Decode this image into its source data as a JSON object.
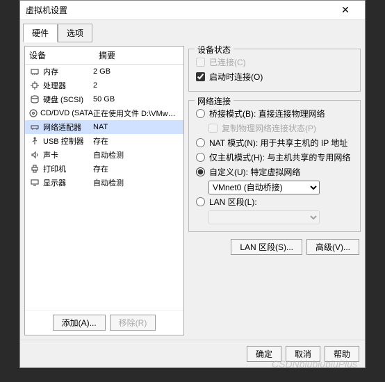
{
  "window": {
    "title": "虚拟机设置"
  },
  "tabs": {
    "hardware": "硬件",
    "options": "选项"
  },
  "hw_header": {
    "device": "设备",
    "summary": "摘要"
  },
  "hardware": [
    {
      "icon": "memory-icon",
      "name": "内存",
      "summary": "2 GB"
    },
    {
      "icon": "cpu-icon",
      "name": "处理器",
      "summary": "2"
    },
    {
      "icon": "disk-icon",
      "name": "硬盘 (SCSI)",
      "summary": "50 GB"
    },
    {
      "icon": "cd-icon",
      "name": "CD/DVD (SATA)",
      "summary": "正在使用文件 D:\\VMware\\ubu..."
    },
    {
      "icon": "network-icon",
      "name": "网络适配器",
      "summary": "NAT"
    },
    {
      "icon": "usb-icon",
      "name": "USB 控制器",
      "summary": "存在"
    },
    {
      "icon": "sound-icon",
      "name": "声卡",
      "summary": "自动检测"
    },
    {
      "icon": "printer-icon",
      "name": "打印机",
      "summary": "存在"
    },
    {
      "icon": "display-icon",
      "name": "显示器",
      "summary": "自动检测"
    }
  ],
  "hw_buttons": {
    "add": "添加(A)...",
    "remove": "移除(R)"
  },
  "device_state": {
    "title": "设备状态",
    "connected": "已连接(C)",
    "connect_on_power": "启动时连接(O)"
  },
  "network": {
    "title": "网络连接",
    "bridged": "桥接模式(B): 直接连接物理网络",
    "replicate": "复制物理网络连接状态(P)",
    "nat": "NAT 模式(N): 用于共享主机的 IP 地址",
    "hostonly": "仅主机模式(H): 与主机共享的专用网络",
    "custom": "自定义(U): 特定虚拟网络",
    "custom_value": "VMnet0 (自动桥接)",
    "lan_segment": "LAN 区段(L):",
    "lan_value": ""
  },
  "right_buttons": {
    "lan": "LAN 区段(S)...",
    "advanced": "高级(V)..."
  },
  "footer": {
    "ok": "确定",
    "cancel": "取消",
    "help": "帮助"
  },
  "watermark": "CSDNbiubiubiuPlus"
}
